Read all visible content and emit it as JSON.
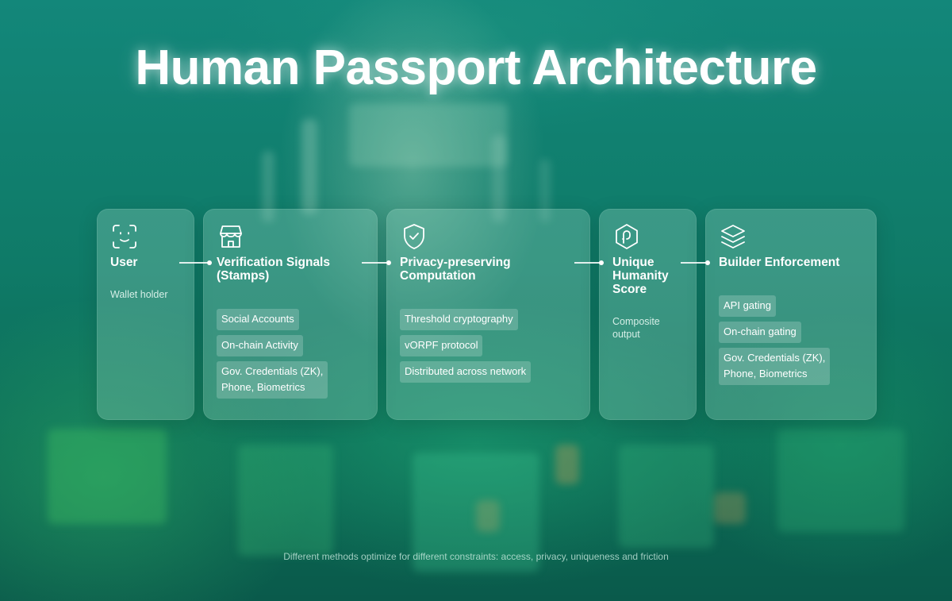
{
  "title": "Human Passport Architecture",
  "colors": {
    "background": "#0f7e68",
    "card": "#9fdcc8",
    "text": "#ffffff"
  },
  "stages": [
    {
      "icon": "face-scan-icon",
      "title": "User",
      "subtitle": "Wallet holder",
      "tags": []
    },
    {
      "icon": "storefront-icon",
      "title": "Verification Signals\n(Stamps)",
      "subtitle": "",
      "tags": [
        "Social Accounts",
        "On-chain Activity",
        "Gov. Credentials (ZK),\nPhone, Biometrics"
      ]
    },
    {
      "icon": "shield-check-icon",
      "title": "Privacy-preserving\nComputation",
      "subtitle": "",
      "tags": [
        "Threshold cryptography",
        "vORPF protocol",
        "Distributed across network"
      ]
    },
    {
      "icon": "humanity-score-icon",
      "title": "Unique\nHumanity\nScore",
      "subtitle": "Composite\noutput",
      "tags": []
    },
    {
      "icon": "layers-icon",
      "title": "Builder Enforcement",
      "subtitle": "",
      "tags": [
        "API gating",
        "On-chain gating",
        "Gov. Credentials (ZK),\nPhone, Biometrics"
      ]
    }
  ],
  "footer": "Different methods optimize for different constraints: access, privacy, uniqueness and friction"
}
